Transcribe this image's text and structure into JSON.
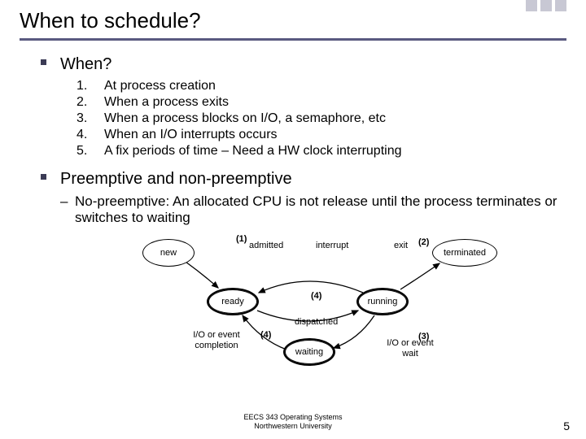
{
  "title": "When to schedule?",
  "bullets": {
    "when": "When?",
    "preempt": "Preemptive and non-preemptive"
  },
  "list": [
    "At process creation",
    "When a process exits",
    "When a process blocks on I/O, a semaphore, etc",
    "When an I/O interrupts occurs",
    "A fix periods of time – Need  a HW clock interrupting"
  ],
  "numbers": [
    "1.",
    "2.",
    "3.",
    "4.",
    "5."
  ],
  "dash": "–",
  "nonpreemptive": "No-preemptive: An allocated CPU is not release until the process terminates or switches to waiting",
  "diagram": {
    "nodes": {
      "new": "new",
      "terminated": "terminated",
      "ready": "ready",
      "running": "running",
      "waiting": "waiting"
    },
    "edges": {
      "admitted": "admitted",
      "interrupt": "interrupt",
      "exit": "exit",
      "dispatched": "dispatched",
      "iocomplete_l1": "I/O or event",
      "iocomplete_l2": "completion",
      "iowait_l1": "I/O or event",
      "iowait_l2": "wait"
    },
    "nums": {
      "n1": "(1)",
      "n2": "(2)",
      "n3": "(3)",
      "n4a": "(4)",
      "n4b": "(4)"
    }
  },
  "footer": {
    "l1": "EECS 343 Operating Systems",
    "l2": "Northwestern University"
  },
  "page": "5"
}
